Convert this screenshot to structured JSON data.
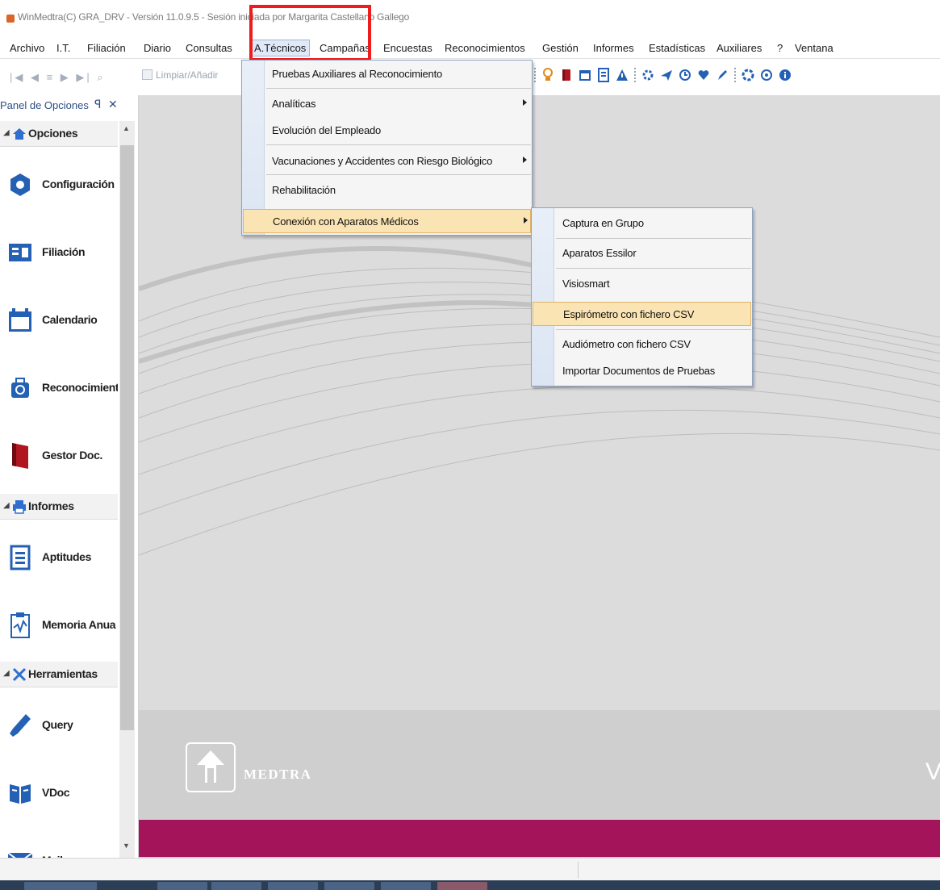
{
  "window": {
    "title": "WinMedtra(C) GRA_DRV - Versión 11.0.9.5 - Sesión iniciada por Margarita Castellano Gallego"
  },
  "menubar": {
    "items": [
      "Archivo",
      "I.T.",
      "Filiación",
      "Diario",
      "Consultas",
      "A.Técnicos",
      "Campañas",
      "Encuestas",
      "Reconocimientos",
      "Gestión",
      "Informes",
      "Estadísticas",
      "Auxiliares",
      "?",
      "Ventana"
    ],
    "open_item": "A.Técnicos"
  },
  "toolbar": {
    "nav_buttons": "|◀ ◀ ≡ ▶ ▶| ⌕",
    "clear_label": "Limpiar/Añadir"
  },
  "sidebar": {
    "header": "Panel de Opciones",
    "pin": "ꟼ",
    "close": "✕",
    "sections": [
      {
        "label": "Opciones",
        "icon": "home-icon"
      },
      {
        "label": "Informes",
        "icon": "printer-icon"
      },
      {
        "label": "Herramientas",
        "icon": "tools-icon"
      }
    ],
    "items": [
      {
        "label": "Configuración",
        "icon": "gear-icon"
      },
      {
        "label": "Filiación",
        "icon": "id-card-icon"
      },
      {
        "label": "Calendario",
        "icon": "calendar-icon"
      },
      {
        "label": "Reconocimient",
        "icon": "medical-bag-icon"
      },
      {
        "label": "Gestor Doc.",
        "icon": "book-icon"
      },
      {
        "label": "Aptitudes",
        "icon": "document-icon"
      },
      {
        "label": "Memoria Anua",
        "icon": "report-chart-icon"
      },
      {
        "label": "Query",
        "icon": "wrench-icon"
      },
      {
        "label": "VDoc",
        "icon": "book-open-icon"
      },
      {
        "label": "Mail",
        "icon": "mail-icon"
      }
    ]
  },
  "menu_tecnicos": {
    "items": [
      {
        "label": "Pruebas Auxiliares al Reconocimiento",
        "submenu": false
      },
      {
        "label": "Analíticas",
        "submenu": true
      },
      {
        "label": "Evolución del Empleado",
        "submenu": false
      },
      {
        "label": "Vacunaciones y Accidentes con Riesgo Biológico",
        "submenu": true
      },
      {
        "label": "Rehabilitación",
        "submenu": false
      },
      {
        "label": "Conexión con Aparatos Médicos",
        "submenu": true,
        "highlighted": true
      }
    ]
  },
  "menu_aparatos": {
    "items": [
      {
        "label": "Captura en Grupo"
      },
      {
        "label": "Aparatos Essilor"
      },
      {
        "label": "Visiosmart"
      },
      {
        "label": "Espirómetro con fichero CSV",
        "highlighted": true
      },
      {
        "label": "Audiómetro con fichero CSV"
      },
      {
        "label": "Importar Documentos de Pruebas"
      }
    ]
  },
  "brand": {
    "name": "MEDTRA",
    "edge_text": "V"
  },
  "colors": {
    "highlight_box": "#ee1c1c",
    "brand_bar": "#a3145a",
    "menu_highlight": "#fbe4b4"
  }
}
